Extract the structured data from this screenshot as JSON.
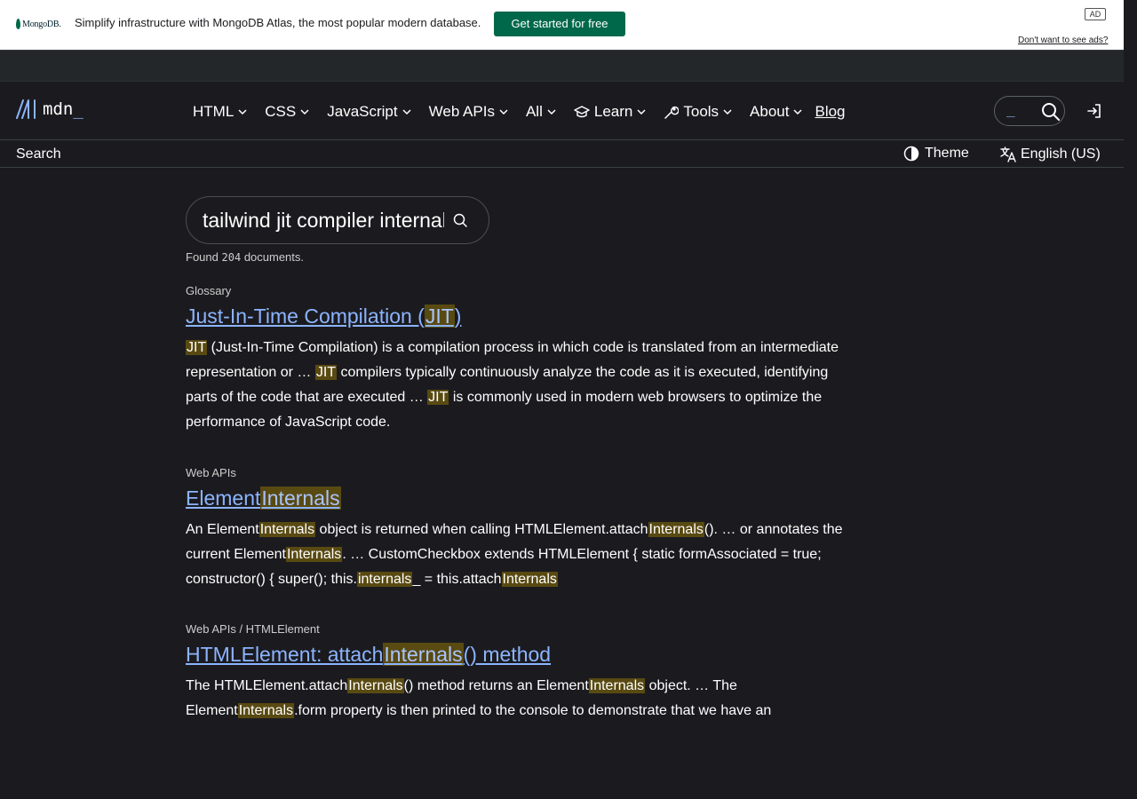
{
  "ad": {
    "brand": "MongoDB.",
    "text": "Simplify infrastructure with MongoDB Atlas, the most popular modern database.",
    "cta": "Get started for free",
    "badge": "AD",
    "optout": "Don't want to see ads?"
  },
  "header": {
    "logo_text": "mdn",
    "nav": [
      {
        "label": "HTML"
      },
      {
        "label": "CSS"
      },
      {
        "label": "JavaScript"
      },
      {
        "label": "Web APIs"
      },
      {
        "label": "All"
      },
      {
        "label": "Learn"
      },
      {
        "label": "Tools"
      },
      {
        "label": "About"
      },
      {
        "label": "Blog"
      }
    ]
  },
  "subbar": {
    "breadcrumb": "Search",
    "theme_label": "Theme",
    "language_label": "English (US)"
  },
  "search": {
    "query": "tailwind jit compiler internals",
    "found_prefix": "Found",
    "found_count": "204",
    "found_suffix": "documents."
  },
  "results": [
    {
      "category": "Glossary",
      "title": [
        "Just-In-Time Compilation (",
        {
          "hl": "JIT"
        },
        ")"
      ],
      "body": [
        {
          "hl": "JIT"
        },
        " (Just-In-Time Compilation) is a compilation process in which code is translated from an intermediate representation or … ",
        {
          "hl": "JIT"
        },
        " compilers typically continuously analyze the code as it is executed, identifying parts of the code that are executed … ",
        {
          "hl": "JIT"
        },
        " is commonly used in modern web browsers to optimize the performance of JavaScript code."
      ]
    },
    {
      "category": "Web APIs",
      "title": [
        "Element",
        {
          "hl": "Internals"
        }
      ],
      "body": [
        "An Element",
        {
          "hl": "Internals"
        },
        " object is returned when calling HTMLElement.attach",
        {
          "hl": "Internals"
        },
        "(). … or annotates the current Element",
        {
          "hl": "Internals"
        },
        ". … CustomCheckbox extends HTMLElement { static formAssociated = true; constructor() { super(); this.",
        {
          "hl": "internals"
        },
        "_ = this.attach",
        {
          "hl": "Internals"
        }
      ]
    },
    {
      "category": "Web APIs / HTMLElement",
      "title": [
        "HTMLElement: attach",
        {
          "hl": "Internals"
        },
        "() method"
      ],
      "body": [
        "The HTMLElement.attach",
        {
          "hl": "Internals"
        },
        "() method returns an Element",
        {
          "hl": "Internals"
        },
        " object. … The Element",
        {
          "hl": "Internals"
        },
        ".form property is then printed to the console to demonstrate that we have an"
      ]
    }
  ],
  "colors": {
    "background": "#1b1b1f",
    "link": "#8cb4ff",
    "highlight": "#594a12",
    "ad_cta": "#00684a"
  },
  "icons": [
    "mdn-logo-icon",
    "chevron-down-icon",
    "learn-cap-icon",
    "tools-wrench-icon",
    "search-icon",
    "login-icon",
    "theme-icon",
    "language-icon"
  ]
}
